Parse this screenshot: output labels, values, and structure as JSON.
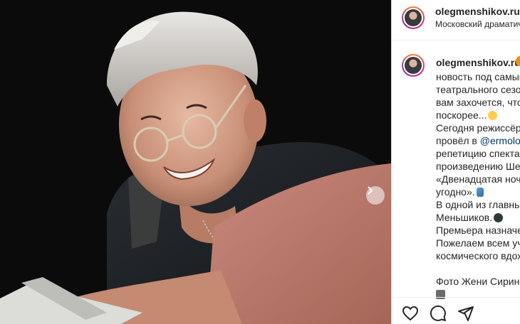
{
  "post": {
    "image_alt": "Фото поста",
    "next_icon": "chevron-right-icon"
  },
  "header": {
    "username": "olegmenshikov.ru",
    "location": "Московский драматич"
  },
  "caption": {
    "username": "olegmenshikov.ru",
    "lines": [
      "новость под самый",
      "театрального сезон",
      "вам захочется, чтоб",
      "поскорее...",
      "Сегодня режиссёр",
      "провёл в ",
      "репетицию спектак",
      "произведению Шек",
      "«Двенадцатая ночь",
      "угодно».",
      "В одной из главных",
      "Меньшиков.",
      "Премьера назначен",
      "Пожелаем всем уча",
      "космического вдох",
      "",
      "Фото Жени Сиринс"
    ],
    "mention": "@ermolov"
  },
  "actions": {
    "like_icon": "heart-icon",
    "comment_icon": "comment-icon",
    "share_icon": "paper-plane-icon"
  },
  "colors": {
    "mention": "#00376b",
    "border": "#dbdbdb",
    "photo_bg": "#0c0c0c"
  }
}
